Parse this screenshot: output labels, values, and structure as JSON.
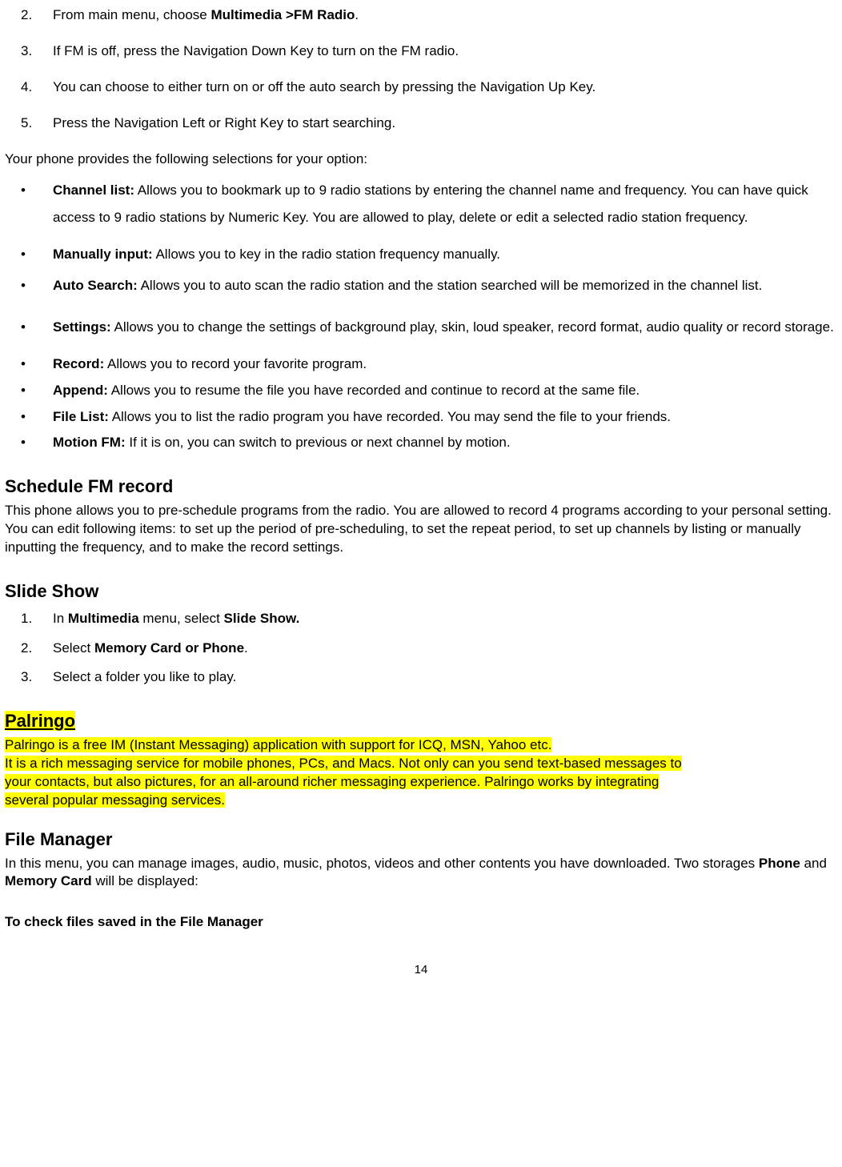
{
  "ol1": {
    "items": [
      {
        "num": "2.",
        "prefix": "From main menu, choose ",
        "bold": "Multimedia >FM Radio",
        "suffix": "."
      },
      {
        "num": "3.",
        "text": "If FM is off, press the Navigation Down Key to turn on the FM radio."
      },
      {
        "num": "4.",
        "text": "You can choose to either turn on or off the auto search by pressing the Navigation Up Key."
      },
      {
        "num": "5.",
        "text": "Press the Navigation Left or Right Key to start searching."
      }
    ]
  },
  "intro_para": "Your phone provides the following selections for your option:",
  "options": [
    {
      "label": "Channel list:",
      "text": " Allows you to bookmark up to 9 radio stations by entering the channel name and frequency. You can have quick access to 9 radio stations by Numeric Key. You are allowed to play, delete or edit a selected radio station frequency."
    },
    {
      "label": "Manually input:",
      "text": " Allows you to key in the radio station frequency manually."
    },
    {
      "label": "Auto Search:",
      "text": " Allows you to auto scan the radio station and the station searched will be memorized in the channel list."
    },
    {
      "label": "Settings:",
      "text": " Allows you to change the settings of background play, skin, loud speaker, record format, audio quality or record storage."
    },
    {
      "label": "Record:",
      "text": " Allows you to record your favorite program."
    },
    {
      "label": "Append:",
      "text": " Allows you to resume the file you have recorded and continue to record at the same file."
    },
    {
      "label": "File List:",
      "text": " Allows you to list the radio program you have recorded. You may send the file to your friends."
    },
    {
      "label": "Motion FM:",
      "text": " If it is on, you can switch to previous or next channel by motion."
    }
  ],
  "schedule": {
    "heading": "Schedule FM record",
    "body": "This phone allows you to pre-schedule programs from the radio. You are allowed to record 4 programs according to your personal setting. You can edit following items: to set up the period of pre-scheduling, to set the repeat period, to set up channels by listing or manually inputting the frequency, and to make the record settings."
  },
  "slideshow": {
    "heading": "Slide Show",
    "items": [
      {
        "num": "1.",
        "prefix": "In ",
        "bold1": "Multimedia",
        "mid": " menu, select ",
        "bold2": "Slide Show."
      },
      {
        "num": "2.",
        "prefix": "Select ",
        "bold1": "Memory Card or Phone",
        "suffix": "."
      },
      {
        "num": "3.",
        "text": "Select a folder you like to play."
      }
    ]
  },
  "palringo": {
    "heading": "Palringo",
    "line1": "Palringo is a free IM (Instant Messaging) application with support for ICQ, MSN, Yahoo etc.",
    "line2a": "It is a rich messaging service for mobile phones, PCs, and Macs. Not only can you send text-based messages to",
    "line2b": "your contacts, but also pictures, for an all-around richer messaging experience. Palringo works by integrating",
    "line2c": "several popular messaging services."
  },
  "filemanager": {
    "heading": "File Manager",
    "body_pre": "In this menu, you can manage images, audio, music, photos, videos and other contents you have downloaded. Two storages ",
    "bold1": "Phone",
    "and": " and ",
    "bold2": "Memory Card",
    "body_post": " will be displayed:"
  },
  "subhead": "To check files saved in the File Manager",
  "pagenum": "14"
}
